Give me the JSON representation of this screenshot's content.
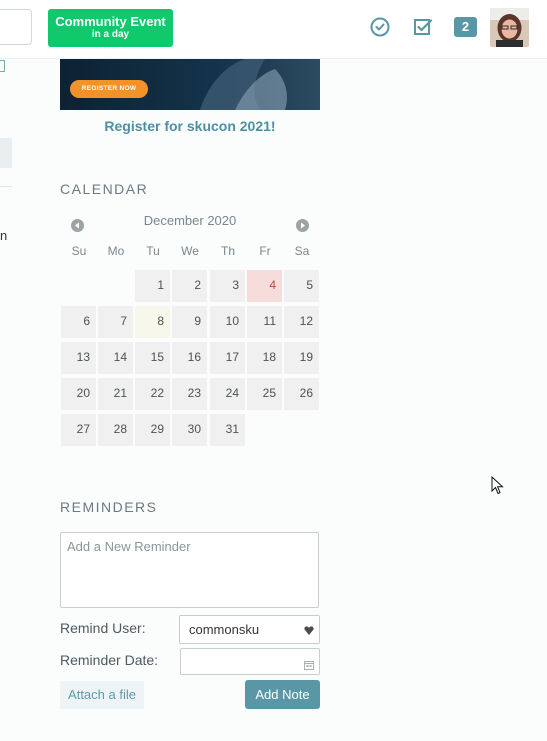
{
  "header": {
    "event_button": {
      "line1": "Community Event",
      "line2": "in a day"
    },
    "icons": [
      "clock-check-icon",
      "edit-check-icon"
    ],
    "notification_count": "2",
    "colors": {
      "accent": "#5996a6",
      "event_green": "#10c96d"
    }
  },
  "promo": {
    "banner_cta": "REGISTER NOW",
    "link_text": "Register for skucon 2021!"
  },
  "sidebar_fragment": {
    "visible_text": "n"
  },
  "calendar": {
    "title": "CALENDAR",
    "month_label": "December 2020",
    "weekdays": [
      "Su",
      "Mo",
      "Tu",
      "We",
      "Th",
      "Fr",
      "Sa"
    ],
    "days": [
      "1",
      "2",
      "3",
      "4",
      "5",
      "6",
      "7",
      "8",
      "9",
      "10",
      "11",
      "12",
      "13",
      "14",
      "15",
      "16",
      "17",
      "18",
      "19",
      "20",
      "21",
      "22",
      "23",
      "24",
      "25",
      "26",
      "27",
      "28",
      "29",
      "30",
      "31"
    ],
    "first_weekday_index": 2,
    "today": "8",
    "event_day": "4"
  },
  "reminders": {
    "title": "REMINDERS",
    "new_reminder_placeholder": "Add a New Reminder",
    "remind_user_label": "Remind User:",
    "remind_user_value": "commonsku",
    "reminder_date_label": "Reminder Date:",
    "attach_label": "Attach a file",
    "add_note_label": "Add Note"
  }
}
